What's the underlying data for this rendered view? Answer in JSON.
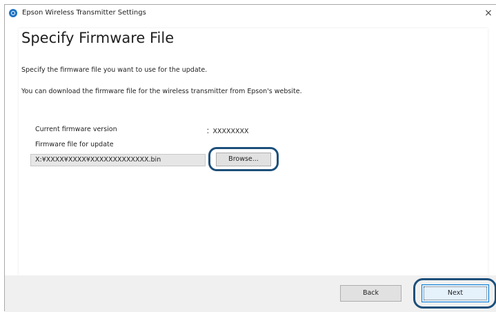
{
  "window": {
    "title": "Epson Wireless Transmitter Settings",
    "close_glyph": "×"
  },
  "page": {
    "title": "Specify Firmware File",
    "description_1": "Specify the firmware file you want to use for the update.",
    "description_2": "You can download the firmware file for the wireless transmitter from Epson's website."
  },
  "firmware": {
    "current_label": "Current firmware version",
    "current_value": "：XXXXXXXX",
    "file_label": "Firmware file for update",
    "file_value": "X:¥XXXX¥XXXX¥XXXXXXXXXXXXX.bin",
    "browse_label": "Browse..."
  },
  "footer": {
    "back_label": "Back",
    "next_label": "Next"
  },
  "colors": {
    "highlight_ring": "#1c4f7a",
    "default_button_border": "#0078d7",
    "footer_background": "#f0f0f0"
  },
  "icons": {
    "app": "epson-app-icon",
    "close": "close-icon"
  }
}
